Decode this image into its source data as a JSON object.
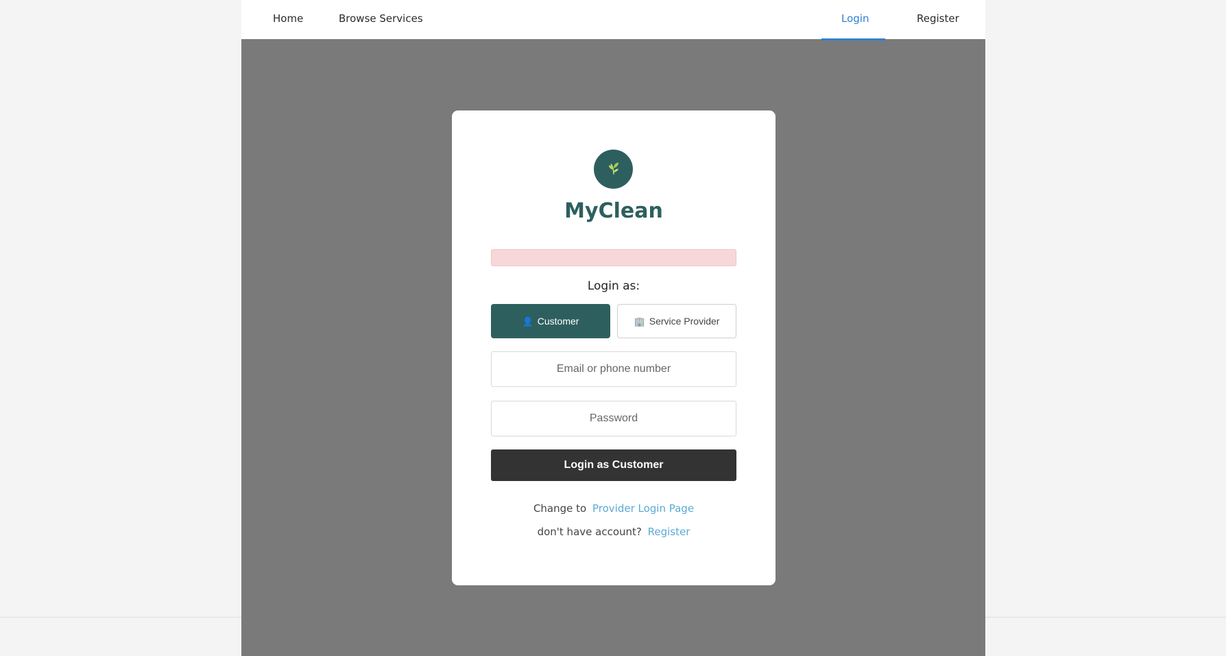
{
  "nav": {
    "home": "Home",
    "browse": "Browse Services",
    "login": "Login",
    "register": "Register"
  },
  "card": {
    "brand": "MyClean",
    "login_as": "Login as:",
    "roles": {
      "customer": {
        "icon": "person-icon",
        "label": "Customer"
      },
      "provider": {
        "icon": "building-icon",
        "label": "Service Provider"
      }
    },
    "email_placeholder": "Email or phone number",
    "password_placeholder": "Password",
    "submit": "Login as Customer",
    "change_prefix": "Change to",
    "change_link": "Provider Login Page",
    "account_prefix": "don't have account?",
    "account_link": "Register"
  },
  "colors": {
    "brand": "#2e5f5f",
    "accent": "#2f7fcf",
    "link": "#5aa9d6",
    "error_bg": "#f7d7da"
  }
}
